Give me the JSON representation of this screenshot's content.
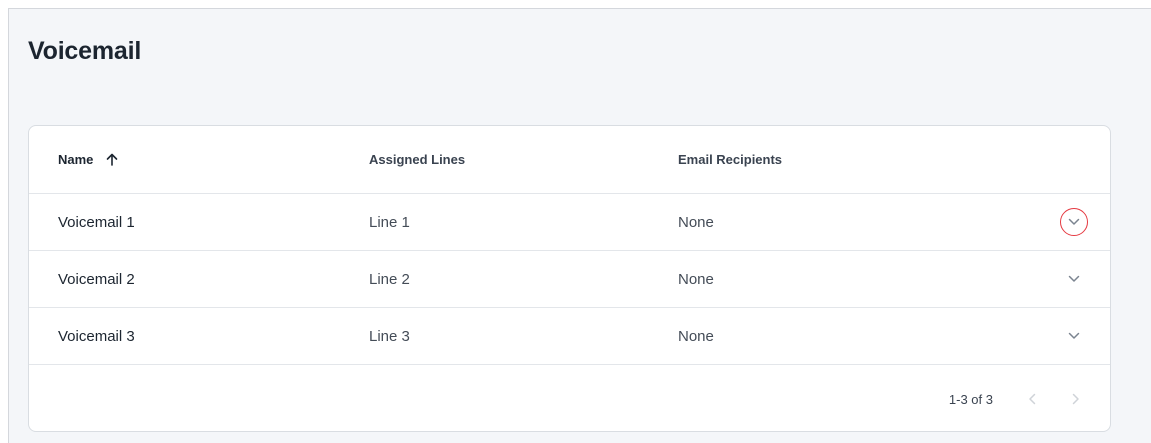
{
  "page": {
    "title": "Voicemail"
  },
  "table": {
    "columns": {
      "name": "Name",
      "lines": "Assigned Lines",
      "email": "Email Recipients"
    },
    "sort": {
      "column": "name",
      "direction": "ascending",
      "icon": "arrow-up-icon"
    },
    "rows": [
      {
        "name": "Voicemail 1",
        "lines": "Line 1",
        "email": "None",
        "expand_icon": "chevron-down-icon",
        "highlighted": true
      },
      {
        "name": "Voicemail 2",
        "lines": "Line 2",
        "email": "None",
        "expand_icon": "chevron-down-icon",
        "highlighted": false
      },
      {
        "name": "Voicemail 3",
        "lines": "Line 3",
        "email": "None",
        "expand_icon": "chevron-down-icon",
        "highlighted": false
      }
    ]
  },
  "pagination": {
    "range_label": "1-3 of 3",
    "prev_icon": "chevron-left-icon",
    "next_icon": "chevron-right-icon"
  },
  "colors": {
    "text_primary": "#1c2530",
    "background": "#f4f6f9",
    "highlight_ring": "#e53941",
    "icon_muted": "#7b8490",
    "icon_disabled": "#cfd3d8"
  }
}
